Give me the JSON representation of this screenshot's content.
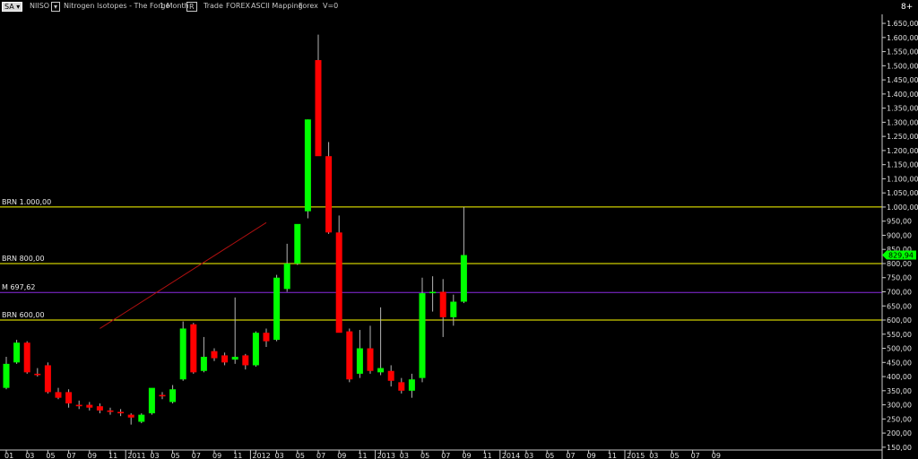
{
  "toolbar": {
    "sa": "SA",
    "symbol": "NIISO",
    "dropdown": "▾",
    "title": "Nitrogen Isotopes - The Forge",
    "period": "1 Month",
    "mode_badge": "R",
    "trade": "Trade",
    "market": "FOREX",
    "mapping": "ASCII Mapping",
    "forex": "Forex",
    "volume": "V=0",
    "menu_icon": "8+"
  },
  "chart_data": {
    "type": "candlestick",
    "ylim": [
      140,
      1720
    ],
    "yticks": [
      "150,00",
      "200,00",
      "250,00",
      "300,00",
      "350,00",
      "400,00",
      "450,00",
      "500,00",
      "550,00",
      "600,00",
      "650,00",
      "700,00",
      "750,00",
      "800,00",
      "850,00",
      "900,00",
      "950,00",
      "1.000,00",
      "1.050,00",
      "1.100,00",
      "1.150,00",
      "1.200,00",
      "1.250,00",
      "1.300,00",
      "1.350,00",
      "1.400,00",
      "1.450,00",
      "1.500,00",
      "1.550,00",
      "1.600,00",
      "1.650,00"
    ],
    "xticks": [
      "01",
      "03",
      "05",
      "07",
      "09",
      "11",
      "2011",
      "03",
      "05",
      "07",
      "09",
      "11",
      "2012",
      "03",
      "05",
      "07",
      "09",
      "11",
      "2013",
      "03",
      "05",
      "07",
      "09",
      "11",
      "2014",
      "03",
      "05",
      "07",
      "09",
      "11",
      "2015",
      "03",
      "05",
      "07",
      "09"
    ],
    "current_price": "829,94",
    "colors": {
      "up": "#00ff00",
      "down": "#ff0000",
      "wick": "#b4b4b4",
      "level": "#ffff00",
      "mid": "#8a2be2",
      "trend": "#b01010",
      "grid": "#222222"
    },
    "levels": [
      {
        "label": "BRN 1.000,00",
        "value": 1000,
        "color": "#ffff00"
      },
      {
        "label": "BRN 800,00",
        "value": 800,
        "color": "#ffff00"
      },
      {
        "label": "M 697,62",
        "value": 697.62,
        "color": "#8a2be2"
      },
      {
        "label": "BRN 600,00",
        "value": 600,
        "color": "#ffff00"
      }
    ],
    "trendline": [
      {
        "x": 9,
        "y": 570
      },
      {
        "x": 25,
        "y": 945
      }
    ],
    "candles": [
      {
        "o": 360,
        "h": 470,
        "l": 355,
        "c": 445
      },
      {
        "o": 450,
        "h": 530,
        "l": 445,
        "c": 520
      },
      {
        "o": 520,
        "h": 525,
        "l": 410,
        "c": 415
      },
      {
        "o": 410,
        "h": 430,
        "l": 400,
        "c": 405
      },
      {
        "o": 440,
        "h": 450,
        "l": 340,
        "c": 345
      },
      {
        "o": 345,
        "h": 360,
        "l": 320,
        "c": 325
      },
      {
        "o": 345,
        "h": 355,
        "l": 290,
        "c": 305
      },
      {
        "o": 300,
        "h": 315,
        "l": 285,
        "c": 295
      },
      {
        "o": 300,
        "h": 310,
        "l": 280,
        "c": 290
      },
      {
        "o": 295,
        "h": 305,
        "l": 270,
        "c": 280
      },
      {
        "o": 280,
        "h": 290,
        "l": 265,
        "c": 275
      },
      {
        "o": 275,
        "h": 285,
        "l": 260,
        "c": 270
      },
      {
        "o": 265,
        "h": 270,
        "l": 230,
        "c": 255
      },
      {
        "o": 240,
        "h": 270,
        "l": 235,
        "c": 265
      },
      {
        "o": 270,
        "h": 350,
        "l": 265,
        "c": 360
      },
      {
        "o": 335,
        "h": 345,
        "l": 320,
        "c": 330
      },
      {
        "o": 310,
        "h": 370,
        "l": 305,
        "c": 355
      },
      {
        "o": 390,
        "h": 595,
        "l": 385,
        "c": 570
      },
      {
        "o": 585,
        "h": 590,
        "l": 410,
        "c": 415
      },
      {
        "o": 420,
        "h": 540,
        "l": 415,
        "c": 470
      },
      {
        "o": 490,
        "h": 500,
        "l": 455,
        "c": 465
      },
      {
        "o": 475,
        "h": 485,
        "l": 440,
        "c": 450
      },
      {
        "o": 460,
        "h": 680,
        "l": 445,
        "c": 470
      },
      {
        "o": 475,
        "h": 480,
        "l": 425,
        "c": 440
      },
      {
        "o": 440,
        "h": 560,
        "l": 435,
        "c": 555
      },
      {
        "o": 555,
        "h": 570,
        "l": 505,
        "c": 525
      },
      {
        "o": 530,
        "h": 760,
        "l": 525,
        "c": 750
      },
      {
        "o": 710,
        "h": 870,
        "l": 700,
        "c": 800
      },
      {
        "o": 800,
        "h": 920,
        "l": 795,
        "c": 940
      },
      {
        "o": 985,
        "h": 1310,
        "l": 960,
        "c": 1310
      },
      {
        "o": 1520,
        "h": 1610,
        "l": 1190,
        "c": 1180
      },
      {
        "o": 1180,
        "h": 1230,
        "l": 905,
        "c": 910
      },
      {
        "o": 910,
        "h": 970,
        "l": 795,
        "c": 555
      },
      {
        "o": 560,
        "h": 570,
        "l": 380,
        "c": 390
      },
      {
        "o": 410,
        "h": 565,
        "l": 395,
        "c": 500
      },
      {
        "o": 500,
        "h": 580,
        "l": 410,
        "c": 420
      },
      {
        "o": 415,
        "h": 645,
        "l": 405,
        "c": 430
      },
      {
        "o": 420,
        "h": 440,
        "l": 365,
        "c": 385
      },
      {
        "o": 380,
        "h": 395,
        "l": 340,
        "c": 350
      },
      {
        "o": 350,
        "h": 410,
        "l": 325,
        "c": 390
      },
      {
        "o": 395,
        "h": 750,
        "l": 380,
        "c": 695
      },
      {
        "o": 695,
        "h": 755,
        "l": 630,
        "c": 700
      },
      {
        "o": 700,
        "h": 745,
        "l": 540,
        "c": 610
      },
      {
        "o": 610,
        "h": 690,
        "l": 580,
        "c": 665
      },
      {
        "o": 665,
        "h": 1000,
        "l": 660,
        "c": 830
      }
    ]
  }
}
